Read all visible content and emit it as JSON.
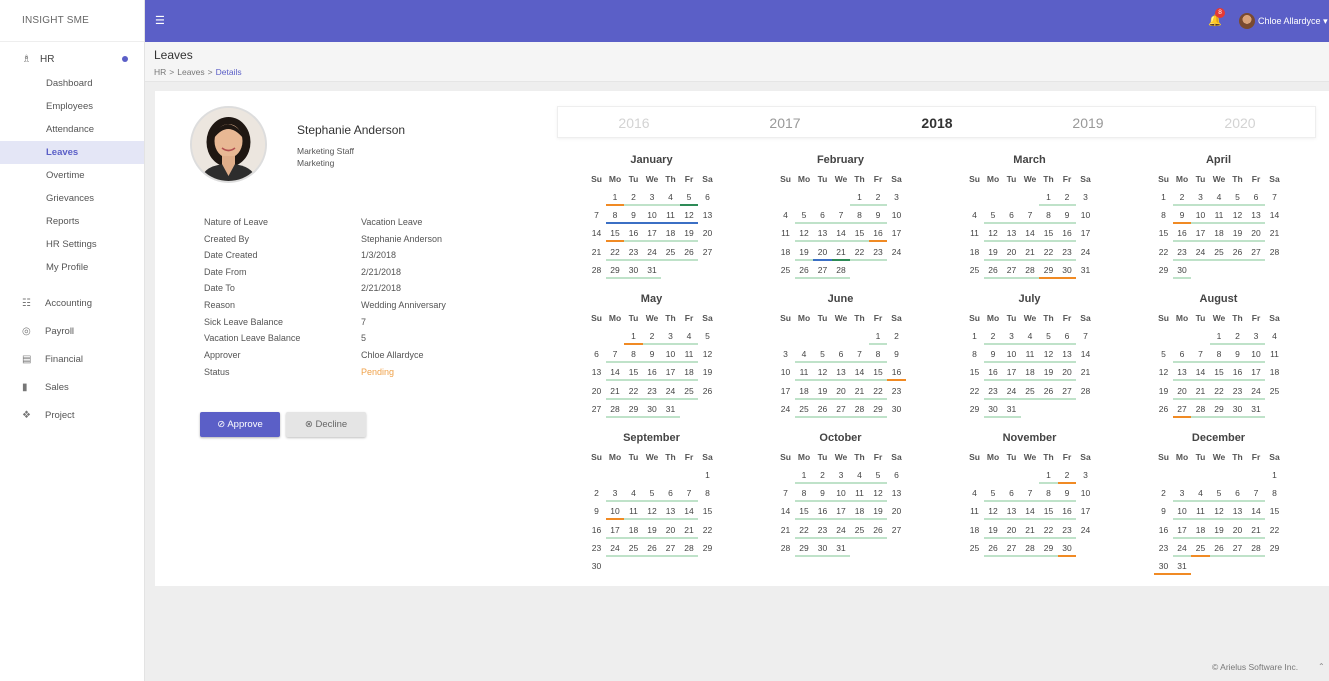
{
  "brand": "INSIGHT SME",
  "sidebar": {
    "hr_label": "HR",
    "hr_items": [
      "Dashboard",
      "Employees",
      "Attendance",
      "Leaves",
      "Overtime",
      "Grievances",
      "Reports",
      "HR Settings",
      "My Profile"
    ],
    "active_item": "Leaves",
    "modules": [
      {
        "label": "Accounting",
        "icon": "accounting-icon"
      },
      {
        "label": "Payroll",
        "icon": "payroll-icon"
      },
      {
        "label": "Financial",
        "icon": "financial-icon"
      },
      {
        "label": "Sales",
        "icon": "sales-icon"
      },
      {
        "label": "Project",
        "icon": "project-icon"
      }
    ]
  },
  "topbar": {
    "notification_count": "8",
    "user_name": "Chloe Allardyce"
  },
  "header": {
    "title": "Leaves",
    "breadcrumb": [
      "HR",
      "Leaves",
      "Details"
    ]
  },
  "employee": {
    "name": "Stephanie Anderson",
    "position": "Marketing Staff",
    "department": "Marketing"
  },
  "details": [
    {
      "label": "Nature of Leave",
      "value": "Vacation Leave"
    },
    {
      "label": "Created By",
      "value": "Stephanie Anderson"
    },
    {
      "label": "Date Created",
      "value": "1/3/2018"
    },
    {
      "label": "Date From",
      "value": "2/21/2018"
    },
    {
      "label": "Date To",
      "value": "2/21/2018"
    },
    {
      "label": "Reason",
      "value": "Wedding Anniversary"
    },
    {
      "label": "Sick Leave Balance",
      "value": "7"
    },
    {
      "label": "Vacation Leave Balance",
      "value": "5"
    },
    {
      "label": "Approver",
      "value": "Chloe Allardyce"
    },
    {
      "label": "Status",
      "value": "Pending"
    }
  ],
  "actions": {
    "approve": "Approve",
    "decline": "Decline"
  },
  "years": [
    "2016",
    "2017",
    "2018",
    "2019",
    "2020"
  ],
  "selected_year": "2018",
  "weekdays": [
    "Su",
    "Mo",
    "Tu",
    "We",
    "Th",
    "Fr",
    "Sa"
  ],
  "months": [
    {
      "name": "January",
      "first_weekday": 1,
      "days": 31
    },
    {
      "name": "February",
      "first_weekday": 4,
      "days": 28
    },
    {
      "name": "March",
      "first_weekday": 4,
      "days": 31
    },
    {
      "name": "April",
      "first_weekday": 0,
      "days": 30
    },
    {
      "name": "May",
      "first_weekday": 2,
      "days": 31
    },
    {
      "name": "June",
      "first_weekday": 5,
      "days": 30
    },
    {
      "name": "July",
      "first_weekday": 0,
      "days": 31
    },
    {
      "name": "August",
      "first_weekday": 3,
      "days": 31
    },
    {
      "name": "September",
      "first_weekday": 6,
      "days": 30
    },
    {
      "name": "October",
      "first_weekday": 1,
      "days": 31
    },
    {
      "name": "November",
      "first_weekday": 4,
      "days": 30
    },
    {
      "name": "December",
      "first_weekday": 6,
      "days": 31
    }
  ],
  "marked_days": {
    "holiday": [
      [
        1,
        1
      ],
      [
        1,
        15
      ],
      [
        2,
        16
      ],
      [
        3,
        29
      ],
      [
        3,
        30
      ],
      [
        4,
        9
      ],
      [
        5,
        1
      ],
      [
        6,
        16
      ],
      [
        8,
        27
      ],
      [
        9,
        10
      ],
      [
        11,
        2
      ],
      [
        11,
        30
      ],
      [
        12,
        25
      ],
      [
        12,
        30
      ],
      [
        12,
        31
      ]
    ],
    "leave_blue": [
      [
        1,
        8
      ],
      [
        1,
        9
      ],
      [
        1,
        10
      ],
      [
        1,
        11
      ],
      [
        1,
        12
      ],
      [
        2,
        20
      ]
    ],
    "leave_green": [
      [
        1,
        5
      ],
      [
        2,
        21
      ]
    ],
    "leave_red": [
      [
        2,
        20
      ]
    ]
  },
  "colors": {
    "accent": "#5b5fc7",
    "weekday_line": "#bfe2c9",
    "holiday": "#f08a24",
    "leave_blue": "#3b6fc4",
    "leave_green": "#2e8b57",
    "leave_red": "#c0392b",
    "pending": "#f0a24a"
  },
  "footer": "© Arielus Software Inc."
}
